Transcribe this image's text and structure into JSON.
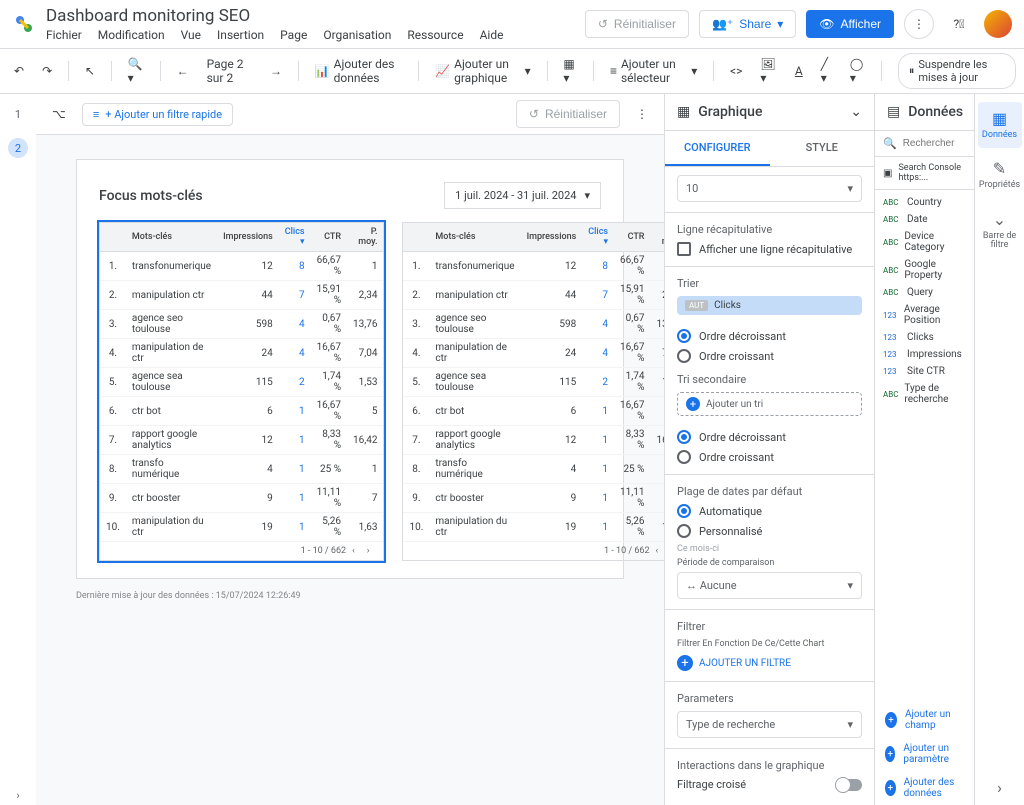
{
  "header": {
    "title": "Dashboard monitoring SEO",
    "menu": [
      "Fichier",
      "Modification",
      "Vue",
      "Insertion",
      "Page",
      "Organisation",
      "Ressource",
      "Aide"
    ],
    "reset": "Réinitialiser",
    "share": "Share",
    "view": "Afficher"
  },
  "toolbar": {
    "page_indicator": "Page 2 sur 2",
    "add_data": "Ajouter des données",
    "add_chart": "Ajouter un graphique",
    "add_selector": "Ajouter un sélecteur",
    "pause_updates": "Suspendre les mises à jour"
  },
  "canvas_bar": {
    "quick_filter": "+ Ajouter un filtre rapide",
    "reset": "Réinitialiser"
  },
  "report": {
    "title": "Focus mots-clés",
    "date_range": "1 juil. 2024 - 31 juil. 2024",
    "update_note": "Dernière mise à jour des données : 15/07/2024 12:26:49",
    "columns": [
      "",
      "Mots-clés",
      "Impressions",
      "Clics",
      "CTR",
      "P. moy."
    ],
    "sorted_col": "Clics",
    "rows": [
      {
        "i": "1.",
        "kw": "transfonumerique",
        "imp": "12",
        "clk": "8",
        "ctr": "66,67 %",
        "pos": "1"
      },
      {
        "i": "2.",
        "kw": "manipulation ctr",
        "imp": "44",
        "clk": "7",
        "ctr": "15,91 %",
        "pos": "2,34"
      },
      {
        "i": "3.",
        "kw": "agence seo toulouse",
        "imp": "598",
        "clk": "4",
        "ctr": "0,67 %",
        "pos": "13,76"
      },
      {
        "i": "4.",
        "kw": "manipulation de ctr",
        "imp": "24",
        "clk": "4",
        "ctr": "16,67 %",
        "pos": "7,04"
      },
      {
        "i": "5.",
        "kw": "agence sea toulouse",
        "imp": "115",
        "clk": "2",
        "ctr": "1,74 %",
        "pos": "1,53"
      },
      {
        "i": "6.",
        "kw": "ctr bot",
        "imp": "6",
        "clk": "1",
        "ctr": "16,67 %",
        "pos": "5"
      },
      {
        "i": "7.",
        "kw": "rapport google analytics",
        "imp": "12",
        "clk": "1",
        "ctr": "8,33 %",
        "pos": "16,42"
      },
      {
        "i": "8.",
        "kw": "transfo numérique",
        "imp": "4",
        "clk": "1",
        "ctr": "25 %",
        "pos": "1"
      },
      {
        "i": "9.",
        "kw": "ctr booster",
        "imp": "9",
        "clk": "1",
        "ctr": "11,11 %",
        "pos": "7"
      },
      {
        "i": "10.",
        "kw": "manipulation du ctr",
        "imp": "19",
        "clk": "1",
        "ctr": "5,26 %",
        "pos": "1,63"
      }
    ],
    "footer": "1 - 10 / 662"
  },
  "chart_panel": {
    "title": "Graphique",
    "tab_config": "CONFIGURER",
    "tab_style": "STYLE",
    "rows_value": "10",
    "summary_section": "Ligne récapitulative",
    "summary_check": "Afficher une ligne récapitulative",
    "sort_label": "Trier",
    "sort_chip": "Clicks",
    "sort_chip_type": "AUT",
    "sort_desc": "Ordre décroissant",
    "sort_asc": "Ordre croissant",
    "sort2_label": "Tri secondaire",
    "add_sort": "Ajouter un tri",
    "daterange_label": "Plage de dates par défaut",
    "date_auto": "Automatique",
    "date_custom": "Personnalisé",
    "this_month": "Ce mois-ci",
    "compare_label": "Période de comparaison",
    "compare_none": "Aucune",
    "filter_label": "Filtrer",
    "filter_sub": "Filtrer En Fonction De Ce/Cette Chart",
    "add_filter": "AJOUTER UN FILTRE",
    "params_label": "Parameters",
    "params_value": "Type de recherche",
    "interact_label": "Interactions dans le graphique",
    "crossfilter": "Filtrage croisé"
  },
  "data_panel": {
    "title": "Données",
    "search_placeholder": "Rechercher",
    "source": "Search Console https:...",
    "fields": [
      {
        "t": "dim",
        "name": "Country"
      },
      {
        "t": "dim",
        "name": "Date"
      },
      {
        "t": "dim",
        "name": "Device Category"
      },
      {
        "t": "dim",
        "name": "Google Property"
      },
      {
        "t": "dim",
        "name": "Query"
      },
      {
        "t": "met",
        "name": "Average Position"
      },
      {
        "t": "met",
        "name": "Clicks"
      },
      {
        "t": "met",
        "name": "Impressions"
      },
      {
        "t": "met",
        "name": "Site CTR"
      },
      {
        "t": "dim",
        "name": "Type de recherche"
      }
    ],
    "add_field": "Ajouter un champ",
    "add_param": "Ajouter un paramètre",
    "add_data": "Ajouter des données"
  },
  "rail": {
    "data": "Données",
    "props": "Propriétés",
    "filters": "Barre de filtre"
  }
}
